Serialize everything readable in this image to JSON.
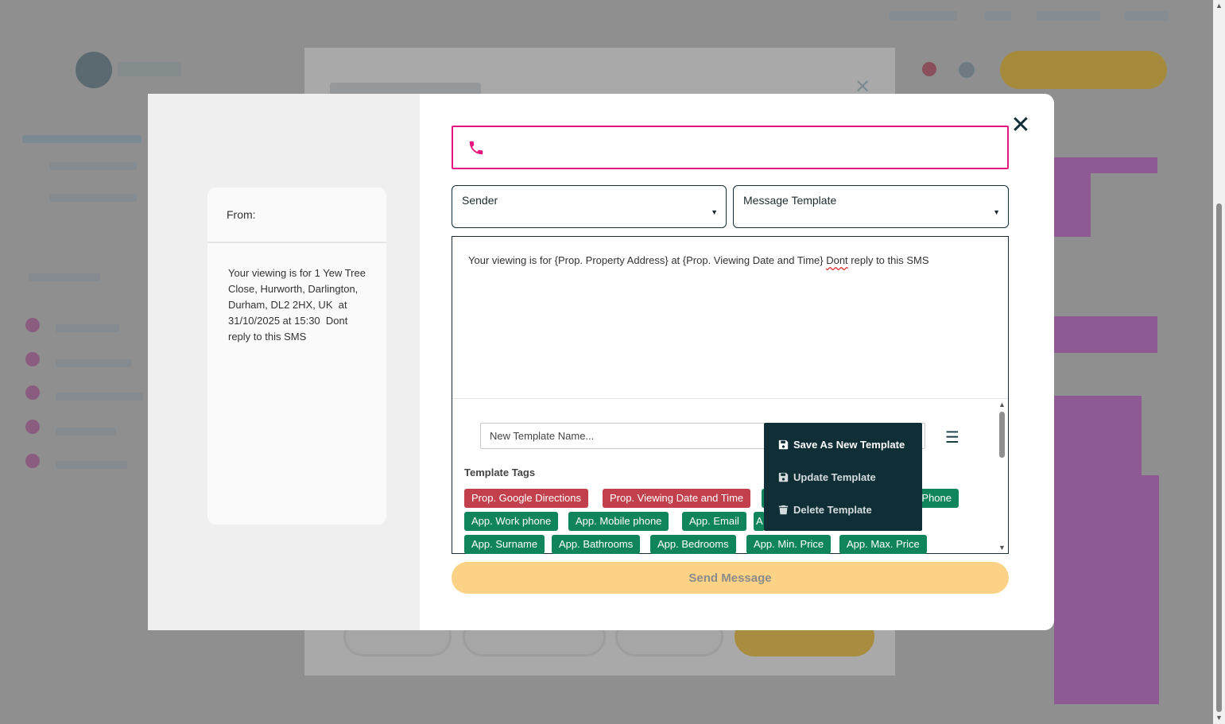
{
  "preview": {
    "from_label": "From:",
    "body": "Your viewing is for 1 Yew Tree Close, Hurworth, Darlington, Durham, DL2 2HX, UK  at 31/10/2025 at 15:30  Dont reply to this SMS"
  },
  "phone": {
    "value": "",
    "icon": "phone-icon"
  },
  "sender": {
    "label": "Sender"
  },
  "message_template": {
    "label": "Message Template"
  },
  "editor": {
    "text_before": "Your viewing is for {Prop. Property Address} at {Prop. Viewing Date and Time} ",
    "text_misspelled": "Dont",
    "text_after": " reply to this SMS"
  },
  "template_name": {
    "placeholder": "New Template Name...",
    "value": ""
  },
  "template_tags": {
    "title": "Template Tags",
    "tags": [
      {
        "label": "Prop. Google Directions",
        "color": "#c2404c"
      },
      {
        "label": "Prop. Viewing Date and Time",
        "color": "#c2404c"
      },
      {
        "label": "Phone",
        "color": "#10855b"
      },
      {
        "label": "App. Work phone",
        "color": "#10855b"
      },
      {
        "label": "App. Mobile phone",
        "color": "#10855b"
      },
      {
        "label": "App. Email",
        "color": "#10855b"
      },
      {
        "label": "A",
        "color": "#10855b"
      },
      {
        "label": "App. Surname",
        "color": "#10855b"
      },
      {
        "label": "App. Bathrooms",
        "color": "#10855b"
      },
      {
        "label": "App. Bedrooms",
        "color": "#10855b"
      },
      {
        "label": "App. Min. Price",
        "color": "#10855b"
      },
      {
        "label": "App. Max. Price",
        "color": "#10855b"
      }
    ]
  },
  "template_menu": {
    "items": [
      {
        "label": "Save As New Template",
        "icon": "floppy-disk-icon"
      },
      {
        "label": "Update Template",
        "icon": "floppy-disk-icon"
      },
      {
        "label": "Delete Template",
        "icon": "trash-icon"
      }
    ]
  },
  "send": {
    "label": "Send Message"
  },
  "colors": {
    "accent_pink": "#e3177f",
    "dark_teal": "#0f2e36",
    "send_button": "#fcd386",
    "tag_red": "#c2404c",
    "tag_green": "#10855b"
  }
}
